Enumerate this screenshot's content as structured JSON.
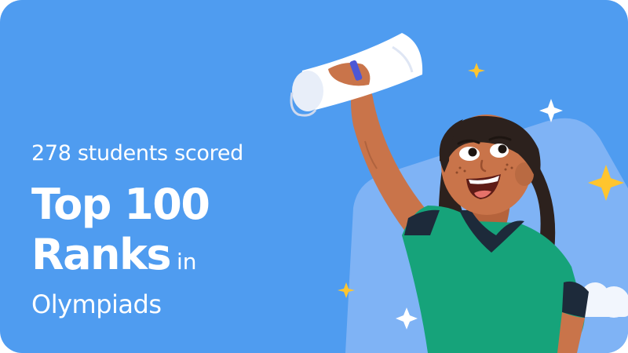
{
  "headline": {
    "line1": "278 students scored",
    "line2": "Top 100",
    "line3_big": "Ranks",
    "line3_small": "in",
    "line4": "Olympiads"
  },
  "colors": {
    "background": "#4f9cf0",
    "shape": "#7fb3f5",
    "shirt": "#16a37a",
    "skin": "#c9744a",
    "hair": "#2c211d",
    "star": "#ffc52e"
  },
  "icons": [
    "sparkle-icon",
    "star-icon",
    "cloud-icon"
  ]
}
